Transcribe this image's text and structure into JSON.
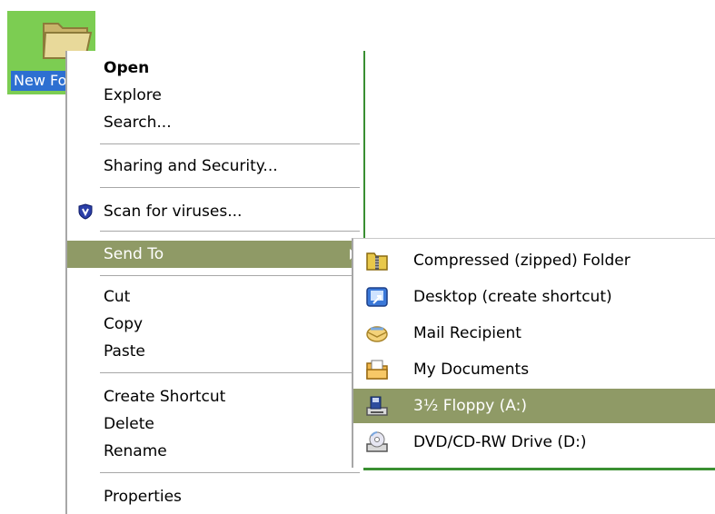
{
  "desktop": {
    "icon_label": "New Folder"
  },
  "context_menu": {
    "items": [
      {
        "label": "Open",
        "bold": true
      },
      {
        "label": "Explore"
      },
      {
        "label": "Search..."
      },
      {
        "label": "Sharing and Security..."
      },
      {
        "label": "Scan for viruses...",
        "icon": "shield-icon"
      },
      {
        "label": "Send To",
        "selected": true,
        "has_submenu": true
      },
      {
        "label": "Cut"
      },
      {
        "label": "Copy"
      },
      {
        "label": "Paste"
      },
      {
        "label": "Create Shortcut"
      },
      {
        "label": "Delete"
      },
      {
        "label": "Rename"
      },
      {
        "label": "Properties"
      }
    ]
  },
  "send_to_submenu": {
    "items": [
      {
        "label": "Compressed (zipped) Folder",
        "icon": "zip-folder-icon"
      },
      {
        "label": "Desktop (create shortcut)",
        "icon": "desktop-shortcut-icon"
      },
      {
        "label": "Mail Recipient",
        "icon": "mail-icon"
      },
      {
        "label": "My Documents",
        "icon": "documents-folder-icon"
      },
      {
        "label": "3½ Floppy (A:)",
        "icon": "floppy-drive-icon",
        "selected": true
      },
      {
        "label": "DVD/CD-RW Drive (D:)",
        "icon": "dvd-drive-icon"
      }
    ]
  },
  "colors": {
    "highlight": "#8f9a66",
    "desktop_green": "#7ccd52",
    "label_selection": "#2d6fd1"
  }
}
